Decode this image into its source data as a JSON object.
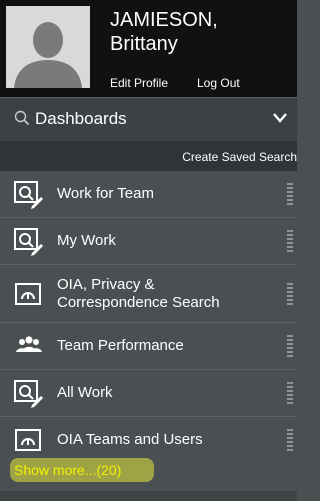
{
  "header": {
    "name_line1": "JAMIESON,",
    "name_line2": "Brittany",
    "edit_profile": "Edit Profile",
    "log_out": "Log Out"
  },
  "dashboards": {
    "title": "Dashboards",
    "create_saved_search": "Create Saved Search"
  },
  "menu": {
    "items": [
      {
        "label": "Work for Team",
        "icon": "search-edit-icon"
      },
      {
        "label": "My Work",
        "icon": "search-edit-icon"
      },
      {
        "label_line1": "OIA, Privacy &",
        "label_line2": "Correspondence Search",
        "icon": "dashboard-gauge-icon"
      },
      {
        "label": "Team Performance",
        "icon": "people-group-icon"
      },
      {
        "label": "All Work",
        "icon": "search-edit-icon"
      },
      {
        "label": "OIA Teams and Users",
        "icon": "dashboard-gauge-icon"
      }
    ]
  },
  "show_more": "Show more...(20)",
  "colors": {
    "header_bg": "#111111",
    "panel_bg": "#4a4f52",
    "highlight": "#e8ea3a",
    "show_more_text": "#eef200"
  }
}
